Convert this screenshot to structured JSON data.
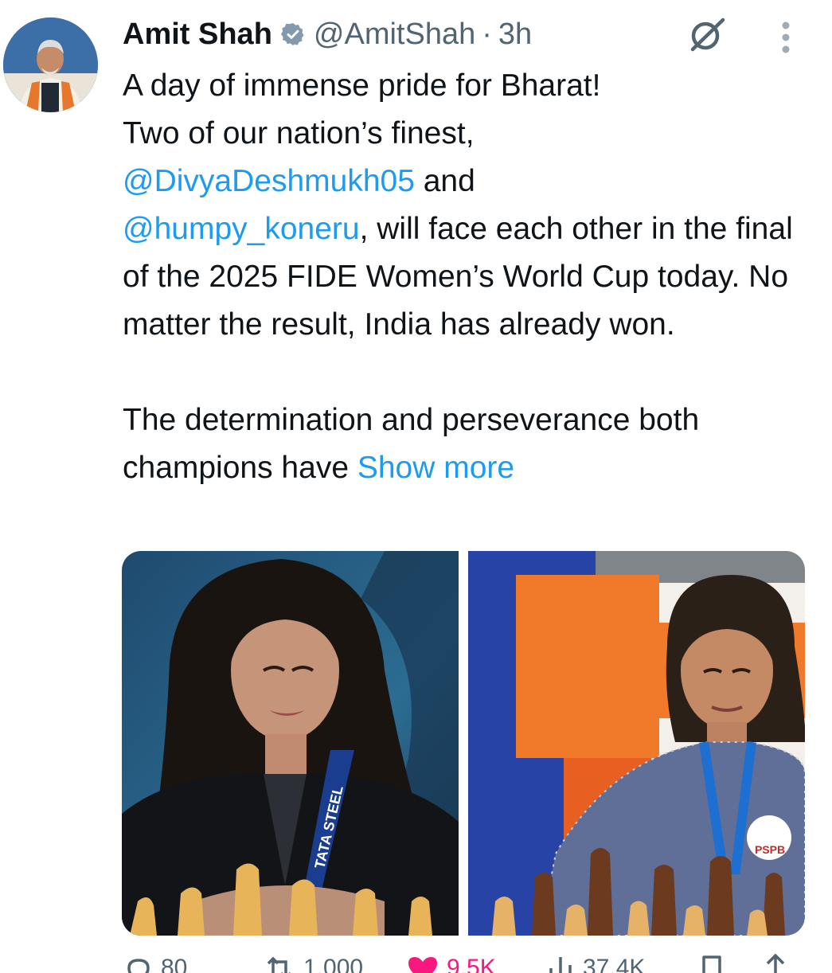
{
  "author": {
    "name": "Amit Shah",
    "handle": "@AmitShah",
    "separator": "·",
    "time": "3h"
  },
  "icons": {
    "avatar": "profile-photo",
    "verified": "verified-badge-icon",
    "grok": "grok-slash-icon",
    "more": "vertical-ellipsis-icon"
  },
  "tweet": {
    "line1": "A day of immense pride for Bharat!",
    "line2": "Two of our nation’s finest,",
    "mention1": "@DivyaDeshmukh05",
    "and": " and",
    "mention2": "@humpy_koneru",
    "after_mention2": ", will face each other in the final of the 2025 FIDE Women’s World Cup today. No matter the result, India has already won.",
    "para2": "The determination and perseverance both champions have ",
    "show_more": "Show more"
  },
  "media": {
    "photo1_alt": "Divya Deshmukh at chessboard",
    "photo1_lanyard": "TATA STEEL",
    "photo2_alt": "Koneru Humpy at chessboard",
    "photo2_badge": "PSPB"
  },
  "metrics": {
    "replies": "80",
    "reposts": "1,000",
    "likes": "9.5K",
    "views": "37.4K"
  },
  "colors": {
    "link": "#1d9bf0",
    "secondary": "#536471",
    "like": "#f91880",
    "verified": "#829aab"
  }
}
